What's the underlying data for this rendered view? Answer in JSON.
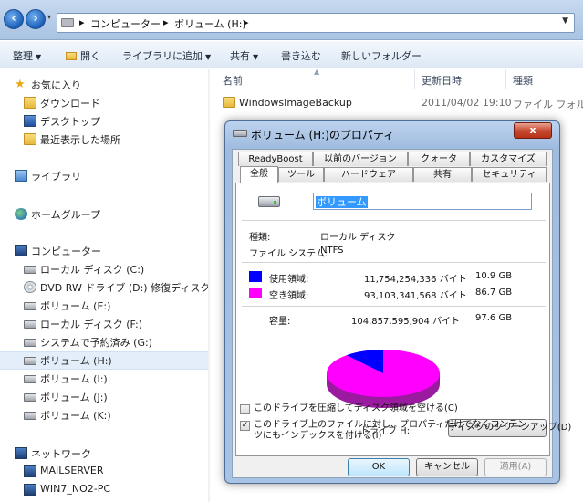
{
  "address": {
    "crumbs": [
      "コンピューター",
      "ボリューム (H:)"
    ],
    "separator": "▸"
  },
  "toolbar": {
    "organize": "整理",
    "open": "開く",
    "add_to_library": "ライブラリに追加",
    "share": "共有",
    "burn": "書き込む",
    "new_folder": "新しいフォルダー"
  },
  "sidebar": {
    "favorites": "お気に入り",
    "downloads": "ダウンロード",
    "desktop": "デスクトップ",
    "recent": "最近表示した場所",
    "libraries": "ライブラリ",
    "homegroup": "ホームグループ",
    "computer": "コンピューター",
    "drives": [
      "ローカル ディスク (C:)",
      "DVD RW ドライブ (D:) 修復ディスク W",
      "ボリューム (E:)",
      "ローカル ディスク (F:)",
      "システムで予約済み (G:)",
      "ボリューム (H:)",
      "ボリューム (I:)",
      "ボリューム (J:)",
      "ボリューム (K:)"
    ],
    "network": "ネットワーク",
    "network_items": [
      "MAILSERVER",
      "WIN7_NO2-PC"
    ]
  },
  "columns": {
    "name": "名前",
    "date": "更新日時",
    "type": "種類"
  },
  "files": [
    {
      "name": "WindowsImageBackup",
      "date": "2011/04/02 19:10",
      "type": "ファイル フォル"
    }
  ],
  "dialog": {
    "title": "ボリューム (H:)のプロパティ",
    "close": "x",
    "tabs_row1": [
      "ReadyBoost",
      "以前のバージョン",
      "クォータ",
      "カスタマイズ"
    ],
    "tabs_row2": [
      "全般",
      "ツール",
      "ハードウェア",
      "共有",
      "セキュリティ"
    ],
    "volume_name": "ボリューム",
    "type_label": "種類:",
    "type_value": "ローカル ディスク",
    "fs_label": "ファイル システム:",
    "fs_value": "NTFS",
    "used_label": "使用領域:",
    "used_bytes": "11,754,254,336 バイト",
    "used_gb": "10.9 GB",
    "free_label": "空き領域:",
    "free_bytes": "93,103,341,568 バイト",
    "free_gb": "86.7 GB",
    "capacity_label": "容量:",
    "capacity_bytes": "104,857,595,904 バイト",
    "capacity_gb": "97.6 GB",
    "drive_label": "ドライブ H:",
    "cleanup_button": "ディスクのクリーンアップ(D)",
    "compress_label": "このドライブを圧縮してディスク領域を空ける(C)",
    "compress_checked": false,
    "index_label": "このドライブ上のファイルに対し、プロパティだけでなくコンテンツにもインデックスを付ける(I)",
    "index_checked": true,
    "ok": "OK",
    "cancel": "キャンセル",
    "apply": "適用(A)",
    "used_fraction": 0.112,
    "used_color": "#0000ff",
    "free_color": "#ff00ff"
  }
}
